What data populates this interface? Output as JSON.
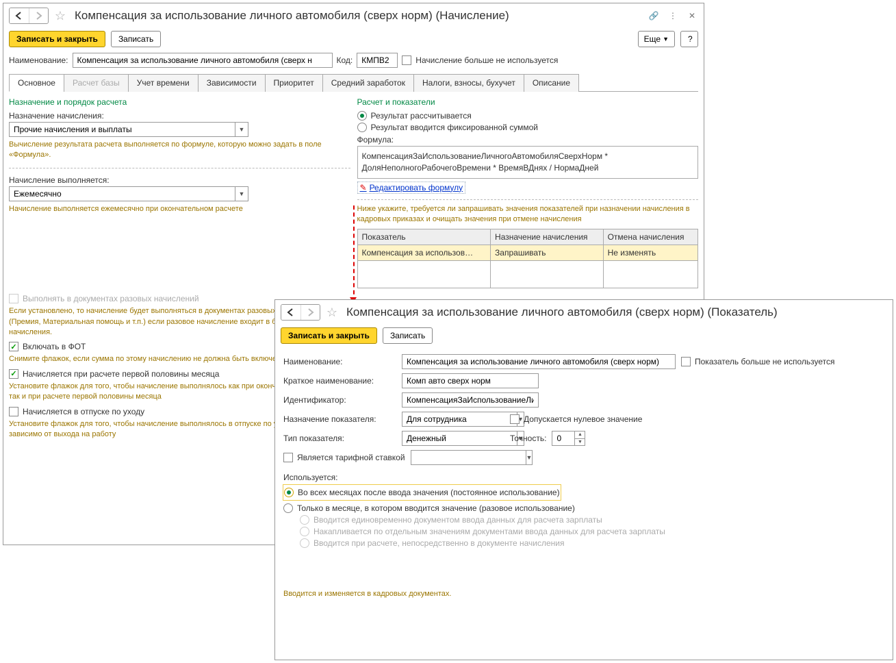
{
  "w1": {
    "title": "Компенсация за использование личного автомобиля (сверх норм) (Начисление)",
    "btn_save_close": "Записать и закрыть",
    "btn_save": "Записать",
    "btn_more": "Еще",
    "btn_help": "?",
    "lbl_name": "Наименование:",
    "val_name": "Компенсация за использование личного автомобиля (сверх н",
    "lbl_code": "Код:",
    "val_code": "КМПВ2",
    "chk_not_used": "Начисление больше не используется",
    "tabs": [
      "Основное",
      "Расчет базы",
      "Учет времени",
      "Зависимости",
      "Приоритет",
      "Средний заработок",
      "Налоги, взносы, бухучет",
      "Описание"
    ],
    "left": {
      "sec": "Назначение и порядок расчета",
      "lbl_purpose": "Назначение начисления:",
      "val_purpose": "Прочие начисления и выплаты",
      "hint_purpose": "Вычисление результата расчета выполняется по формуле, которую можно задать в поле «Формула».",
      "lbl_exec": "Начисление выполняется:",
      "val_exec": "Ежемесячно",
      "hint_exec": "Начисление выполняется ежемесячно при окончательном расчете",
      "chk_once": "Выполнять в документах разовых начислений",
      "hint_once": "Если установлено, то начисление будет выполняться в документах разовых начислений (Премия, Материальная помощь и т.п.) если разовое начисление входит в базу текущего начисления.",
      "chk_fot": "Включать в ФОТ",
      "hint_fot": "Снимите флажок, если сумма по этому начислению не должна быть включена в состав ФОТ",
      "chk_half": "Начисляется при расчете первой половины месяца",
      "hint_half": "Установите флажок для того, чтобы начисление выполнялось как при окончательном расчете, так и при расчете первой половины месяца",
      "chk_leave": "Начисляется в отпуске по уходу",
      "hint_leave": "Установите флажок для того, чтобы начисление выполнялось в отпуске по уходу за ребенком не зависимо от выхода на работу"
    },
    "right": {
      "sec": "Расчет и показатели",
      "rad1": "Результат рассчитывается",
      "rad2": "Результат вводится фиксированной суммой",
      "lbl_formula": "Формула:",
      "formula": "КомпенсацияЗаИспользованиеЛичногоАвтомобиляСверхНорм * ДоляНеполногоРабочегоВремени * ВремяВДнях / НормаДней",
      "link": "Редактировать формулу",
      "hint_tbl": "Ниже укажите, требуется ли запрашивать значения показателей при назначении начисления в кадровых приказах и очищать значения при отмене начисления",
      "th1": "Показатель",
      "th2": "Назначение начисления",
      "th3": "Отмена начисления",
      "td1": "Компенсация за использов…",
      "td2": "Запрашивать",
      "td3": "Не изменять"
    }
  },
  "w2": {
    "title": "Компенсация за использование личного автомобиля (сверх норм) (Показатель)",
    "btn_save_close": "Записать и закрыть",
    "btn_save": "Записать",
    "lbl_name": "Наименование:",
    "val_name": "Компенсация за использование личного автомобиля (сверх норм)",
    "chk_not_used": "Показатель больше не используется",
    "lbl_short": "Краткое наименование:",
    "val_short": "Комп авто сверх норм",
    "lbl_id": "Идентификатор:",
    "val_id": "КомпенсацияЗаИспользованиеЛи",
    "lbl_purpose": "Назначение показателя:",
    "val_purpose": "Для сотрудника",
    "chk_zero": "Допускается нулевое значение",
    "lbl_type": "Тип показателя:",
    "val_type": "Денежный",
    "lbl_precision": "Точность:",
    "val_precision": "0",
    "chk_tariff": "Является тарифной ставкой",
    "lbl_usage": "Используется:",
    "rad_u1": "Во всех месяцах после ввода значения (постоянное использование)",
    "rad_u2": "Только в месяце, в котором вводится значение (разовое использование)",
    "rad_s1": "Вводится единовременно документом ввода данных для расчета зарплаты",
    "rad_s2": "Накапливается по отдельным значениям документами ввода данных для расчета зарплаты",
    "rad_s3": "Вводится при расчете, непосредственно в документе начисления",
    "footer": "Вводится и изменяется в кадровых документах."
  }
}
